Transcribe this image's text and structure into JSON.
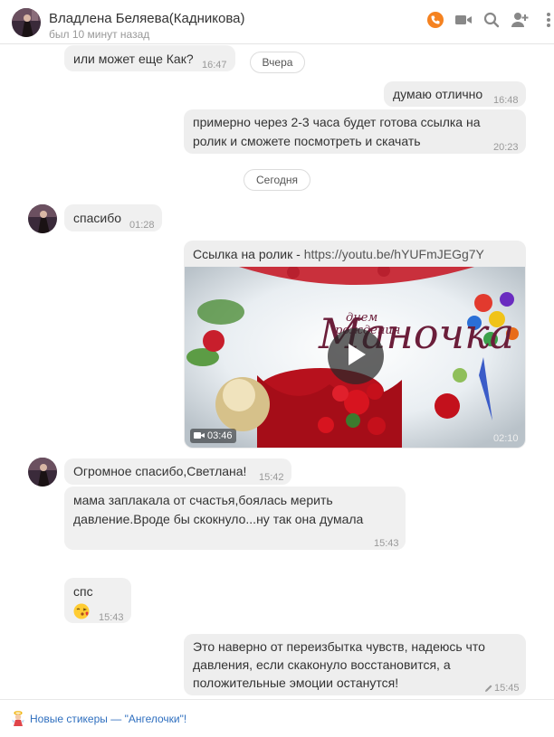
{
  "header": {
    "name": "Владлена Беляева(Кадникова)",
    "status": "был 10 минут назад",
    "icons": [
      "call-icon",
      "video-call-icon",
      "search-icon",
      "add-user-icon",
      "more-icon"
    ],
    "accent": "#f58220"
  },
  "messages": {
    "m1": {
      "text": "или может еще Как?",
      "time": "16:47"
    },
    "date1": "Вчера",
    "m2": {
      "text": "думаю отлично",
      "time": "16:48"
    },
    "m3": {
      "line1": "примерно через 2-3 часа будет готова ссылка на",
      "line2": "ролик и сможете посмотреть и скачать",
      "time": "20:23"
    },
    "date2": "Сегодня",
    "m4": {
      "text": "спасибо",
      "time": "01:28"
    },
    "m5": {
      "prefix": "Ссылка на ролик - ",
      "link": "https://youtu.be/hYUFmJEGg7Y",
      "duration": "03:46",
      "time": "02:10",
      "thumb_title": "Маночка",
      "thumb_subtitle1": "днем",
      "thumb_subtitle2": "рождения"
    },
    "m6": {
      "text": "Огромное спасибо,Светлана!",
      "time": "15:42"
    },
    "m7": {
      "line1": "мама заплакала от счастья,боялась мерить",
      "line2": "давление.Вроде бы скокнуло...ну так она думала",
      "time": "15:43"
    },
    "m8": {
      "text": "спс",
      "emoji": "😘",
      "time": "15:43"
    },
    "m9": {
      "line1": "Это наверно от переизбытка чувств, надеюсь что",
      "line2": "давления, если скаконуло восстановится, а",
      "line3": "положительные эмоции останутся!",
      "time": "15:45"
    }
  },
  "footer": {
    "text": "Новые стикеры — \"Ангелочки\"!"
  }
}
